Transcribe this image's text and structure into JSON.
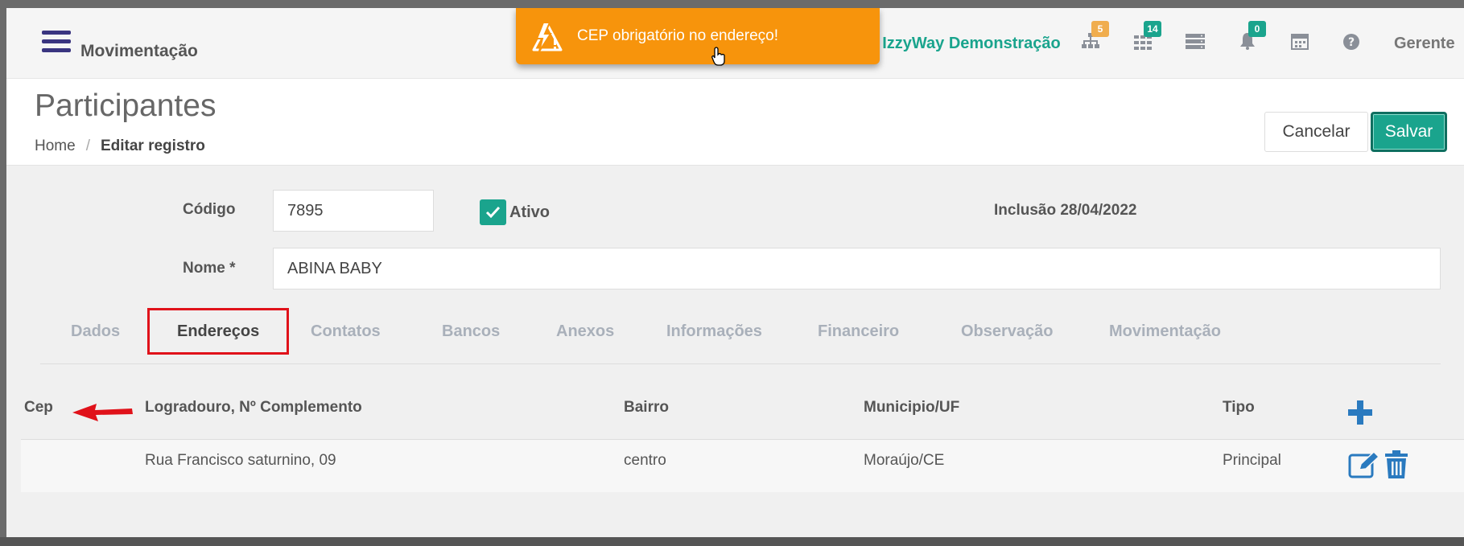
{
  "topbar": {
    "module_title": "Movimentação",
    "company": ": IzzyWay Demonstração",
    "badges": {
      "org": "5",
      "apps": "14",
      "notifications": "0"
    },
    "badge_colors": {
      "org": "#f0ad4e",
      "apps": "#1aa48d",
      "notifications": "#1aa48d"
    },
    "user": "Gerente"
  },
  "toast": {
    "message": "CEP obrigatório no endereço!",
    "color": "#f7940c"
  },
  "page": {
    "title": "Participantes",
    "breadcrumb": {
      "home": "Home",
      "sep": "/",
      "current": "Editar registro"
    },
    "cancel_label": "Cancelar",
    "save_label": "Salvar"
  },
  "form": {
    "code_label": "Código",
    "code_value": "7895",
    "active_label": "Ativo",
    "active_checked": true,
    "inclusion": "Inclusão 28/04/2022",
    "name_label": "Nome *",
    "name_value": "ABINA BABY"
  },
  "tabs": [
    "Dados",
    "Endereços",
    "Contatos",
    "Bancos",
    "Anexos",
    "Informações",
    "Financeiro",
    "Observação",
    "Movimentação"
  ],
  "active_tab": "Endereços",
  "table": {
    "headers": {
      "cep": "Cep",
      "logradouro": "Logradouro, Nº Complemento",
      "bairro": "Bairro",
      "municipio": "Municipio/UF",
      "tipo": "Tipo"
    },
    "rows": [
      {
        "cep": "",
        "logradouro": "Rua Francisco saturnino, 09",
        "bairro": "centro",
        "municipio": "Moraújo/CE",
        "tipo": "Principal"
      }
    ]
  },
  "colors": {
    "accent": "#1aa48d",
    "brand_dark": "#3a3580",
    "highlight": "#e0121a",
    "action_blue": "#2a7abf"
  }
}
